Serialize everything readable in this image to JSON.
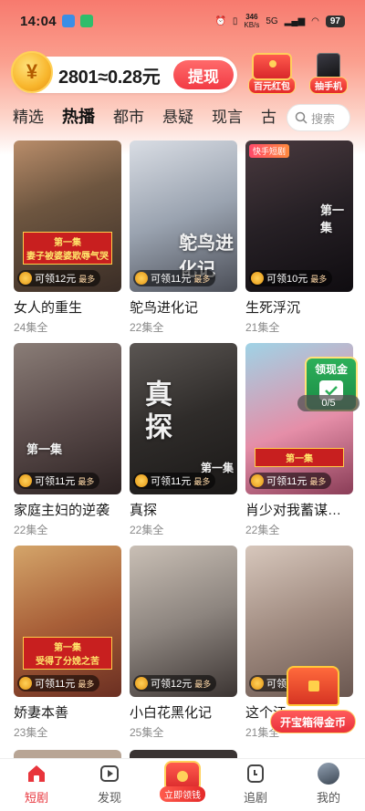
{
  "status_bar": {
    "time": "14:04",
    "speed_value": "346",
    "speed_unit": "KB/s",
    "network": "5G",
    "battery": "97"
  },
  "wallet": {
    "coin_symbol": "¥",
    "balance_text": "2801≈0.28元",
    "withdraw_label": "提现"
  },
  "promos": [
    {
      "label": "百元红包"
    },
    {
      "label": "抽手机"
    }
  ],
  "tabs": [
    {
      "label": "精选",
      "active": false
    },
    {
      "label": "热播",
      "active": true
    },
    {
      "label": "都市",
      "active": false
    },
    {
      "label": "悬疑",
      "active": false
    },
    {
      "label": "现言",
      "active": false
    },
    {
      "label": "古",
      "active": false
    }
  ],
  "search": {
    "placeholder": "搜索"
  },
  "dramas": [
    {
      "title": "女人的重生",
      "episodes": "24集全",
      "reward": "可领12元",
      "most": "最多",
      "poster_tag": "第一集",
      "poster_caption": "妻子被婆婆欺辱气哭"
    },
    {
      "title": "鸵鸟进化记",
      "episodes": "22集全",
      "reward": "可领11元",
      "most": "最多",
      "poster_word": "鸵鸟进化记"
    },
    {
      "title": "生死浮沉",
      "episodes": "21集全",
      "reward": "可领10元",
      "most": "最多",
      "poster_tag": "第一集",
      "platform_tag": "快手短剧"
    },
    {
      "title": "家庭主妇的逆袭",
      "episodes": "22集全",
      "reward": "可领11元",
      "most": "最多",
      "poster_tag": "第一集"
    },
    {
      "title": "真探",
      "episodes": "22集全",
      "reward": "可领11元",
      "most": "最多",
      "poster_word": "真探",
      "poster_tag": "第一集"
    },
    {
      "title": "肖少对我蓄谋…",
      "episodes": "22集全",
      "reward": "可领11元",
      "most": "最多",
      "poster_tag": "第一集"
    },
    {
      "title": "娇妻本善",
      "episodes": "23集全",
      "reward": "可领11元",
      "most": "最多",
      "poster_tag": "第一集",
      "poster_caption": "受得了分娩之苦"
    },
    {
      "title": "小白花黑化记",
      "episodes": "25集全",
      "reward": "可领12元",
      "most": "最多"
    },
    {
      "title": "这个江",
      "episodes": "21集全",
      "reward": "可领11元",
      "most": "最多"
    }
  ],
  "reward_widget": {
    "label": "领现金",
    "progress": "0/5"
  },
  "treasure": {
    "label": "开宝箱得金币"
  },
  "bottom_nav": [
    {
      "label": "短剧",
      "icon": "home-icon",
      "active": true
    },
    {
      "label": "发现",
      "icon": "play-icon",
      "active": false
    },
    {
      "label": "立即领钱",
      "icon": "red-packet-icon",
      "active": false
    },
    {
      "label": "追剧",
      "icon": "bookmark-icon",
      "active": false
    },
    {
      "label": "我的",
      "icon": "avatar",
      "active": false
    }
  ],
  "colors": {
    "accent": "#f2434b",
    "top_gradient": "#f77a6e"
  }
}
